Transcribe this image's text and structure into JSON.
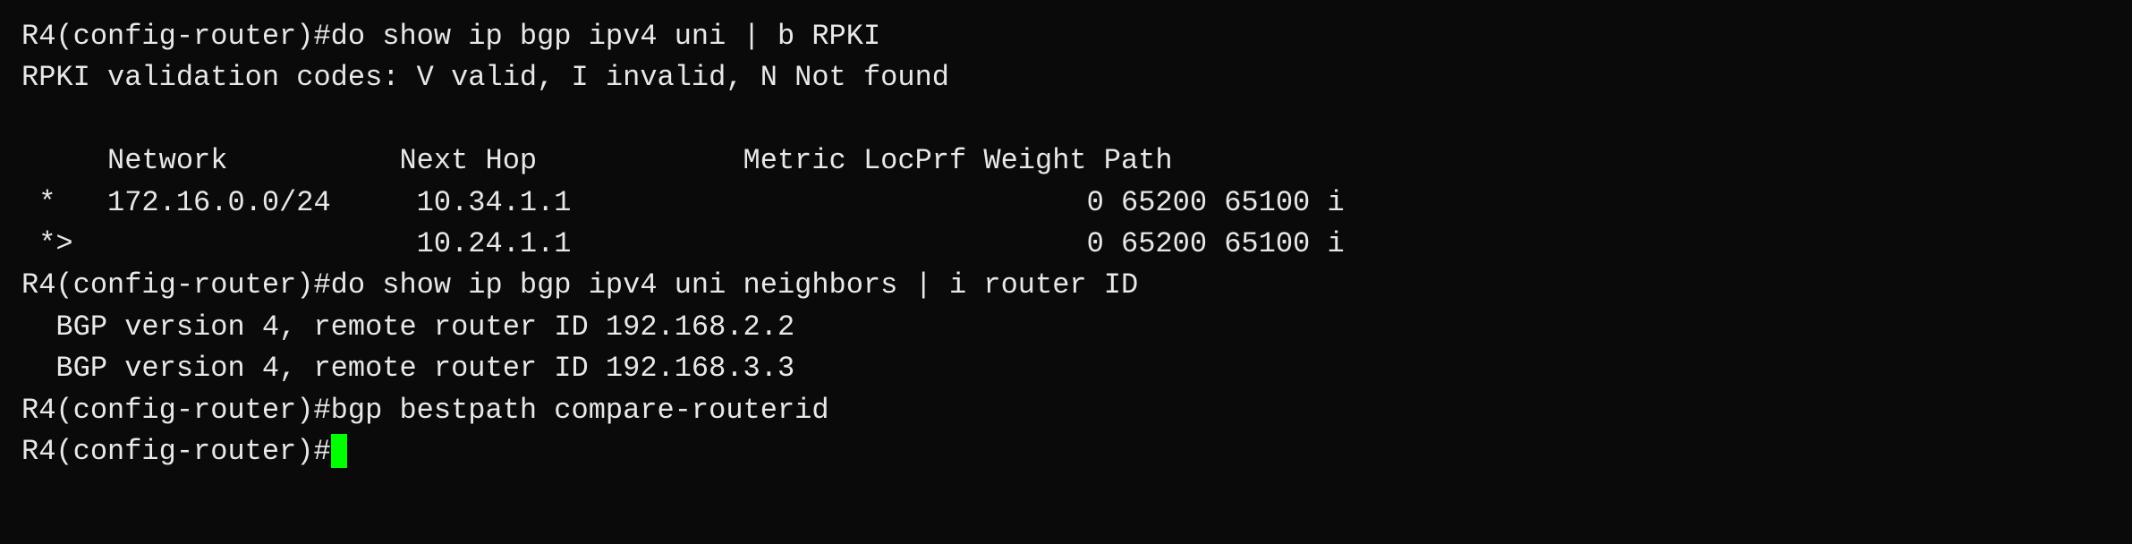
{
  "terminal": {
    "lines": [
      {
        "id": "line1",
        "text": "R4(config-router)#do show ip bgp ipv4 uni | b RPKI"
      },
      {
        "id": "line2",
        "text": "RPKI validation codes: V valid, I invalid, N Not found"
      },
      {
        "id": "line3",
        "text": ""
      },
      {
        "id": "line4",
        "text": "     Network          Next Hop            Metric LocPrf Weight Path"
      },
      {
        "id": "line5",
        "text": " *   172.16.0.0/24     10.34.1.1                              0 65200 65100 i"
      },
      {
        "id": "line6",
        "text": " *>                    10.24.1.1                              0 65200 65100 i"
      },
      {
        "id": "line7",
        "text": "R4(config-router)#do show ip bgp ipv4 uni neighbors | i router ID"
      },
      {
        "id": "line8",
        "text": "  BGP version 4, remote router ID 192.168.2.2"
      },
      {
        "id": "line9",
        "text": "  BGP version 4, remote router ID 192.168.3.3"
      },
      {
        "id": "line10",
        "text": "R4(config-router)#bgp bestpath compare-routerid"
      },
      {
        "id": "line11",
        "text": "R4(config-router)#",
        "has_cursor": true
      }
    ]
  }
}
